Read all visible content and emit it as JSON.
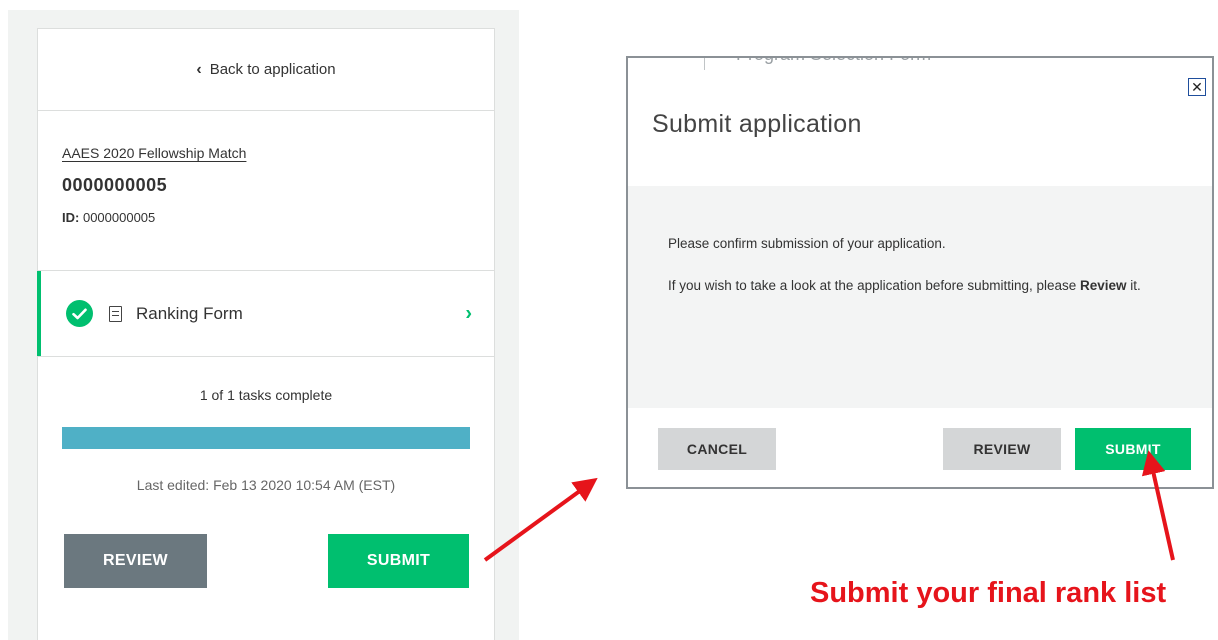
{
  "sidebar": {
    "back_label": "Back to application",
    "match_name": "AAES 2020 Fellowship Match",
    "applicant_number": "0000000005",
    "id_label": "ID:",
    "id_value": "0000000005",
    "task": {
      "label": "Ranking Form",
      "status": "complete"
    },
    "progress_text": "1 of 1 tasks complete",
    "progress_fraction": 1.0,
    "last_edited": "Last edited: Feb 13 2020 10:54 AM (EST)",
    "review_label": "REVIEW",
    "submit_label": "SUBMIT"
  },
  "modal": {
    "background_text": "Program Selection Form",
    "close_icon": "close-icon",
    "title": "Submit application",
    "body_line1": "Please confirm submission of your application.",
    "body_line2_prefix": "If you wish to take a look at the application before submitting, please ",
    "body_line2_bold": "Review",
    "body_line2_suffix": " it.",
    "cancel_label": "CANCEL",
    "review_label": "REVIEW",
    "submit_label": "SUBMIT"
  },
  "annotation": {
    "callout_text": "Submit your final rank list",
    "color": "#e6141b"
  },
  "colors": {
    "brand_green": "#00bf6f",
    "progress_blue": "#4fb0c6",
    "review_gray": "#6b787f"
  }
}
